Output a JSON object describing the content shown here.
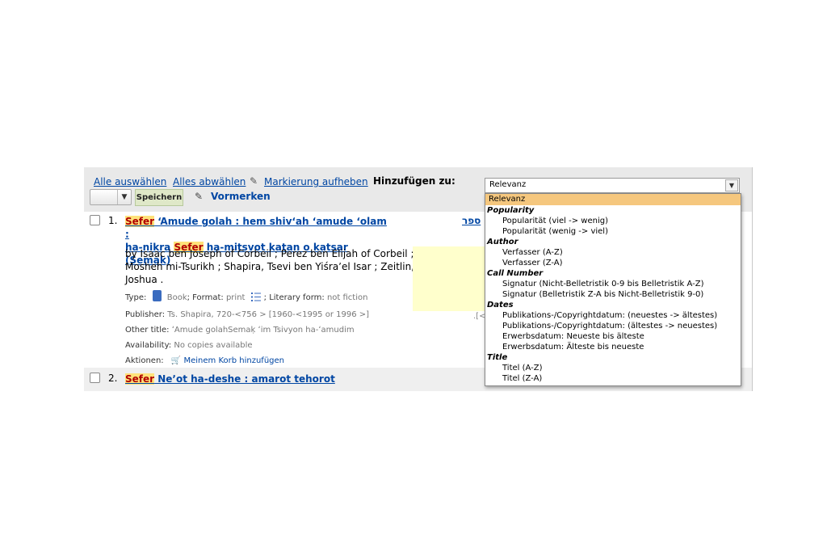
{
  "toolbar": {
    "select_all": "Alle auswählen",
    "clear_all": "Alles abwählen",
    "unhighlight": "Markierung aufheben",
    "add_to_label": "Hinzufügen zu:",
    "save": "Speichern",
    "place_hold": "Vormerken"
  },
  "sort": {
    "selected": "Relevanz",
    "options": [
      {
        "label": "Relevanz",
        "selected": true
      },
      {
        "group": "Popularity"
      },
      {
        "label": "Popularität (viel -> wenig)"
      },
      {
        "label": "Popularität (wenig -> viel)"
      },
      {
        "group": "Author"
      },
      {
        "label": "Verfasser (A-Z)"
      },
      {
        "label": "Verfasser (Z-A)"
      },
      {
        "group": "Call Number"
      },
      {
        "label": "Signatur (Nicht-Belletristik 0-9 bis Belletristik A-Z)"
      },
      {
        "label": "Signatur (Belletristik Z-A bis Nicht-Belletristik 9-0)"
      },
      {
        "group": "Dates"
      },
      {
        "label": "Publikations-/Copyrightdatum: (neuestes -> ältestes)"
      },
      {
        "label": "Publikations-/Copyrightdatum: (ältestes -> neuestes)"
      },
      {
        "label": "Erwerbsdatum: Neueste bis älteste"
      },
      {
        "label": "Erwerbsdatum: Älteste bis neueste"
      },
      {
        "group": "Title"
      },
      {
        "label": "Titel (A-Z)"
      },
      {
        "label": "Titel (Z-A)"
      }
    ]
  },
  "results": [
    {
      "number": "1.",
      "title_hl": "Sefer",
      "title_part1": " ʻAmude golah : hem shivʻah ʻamude ʻolam :",
      "title_part2": "ha-nikra ",
      "title_hl2": "Sefer",
      "title_part3": " ha-mitsvot katan o katsar (Semak)",
      "hebrew_title": "ספר",
      "authors": "by Isaac ben Joseph of Corbeil ; Perez ben Elijah of Corbeil ; Mosheh mi-Tsurikh ; Shapira, Tsevi ben Yiśraʼel Isar ; Zeitlin, Joshua .",
      "type_label": "Type:",
      "type_value": "Book",
      "format_label": "; Format:",
      "format_value": "print",
      "literary_label": "; Literary form:",
      "literary_value": "not fiction",
      "publisher_label": "Publisher:",
      "publisher_value": "Ts. Shapira, 720-<756 > [1960-<1995 or 1996 >]",
      "other_title_label": "Other title:",
      "other_title_value": "ʻAmude golahSemaḳ ʻim Tsivyon ha-ʻamudim",
      "availability_label": "Availability:",
      "availability_value": "No copies available",
      "actions_label": "Aktionen:",
      "cart_label": "Meinem Korb hinzufügen",
      "cover_note": ".[<"
    },
    {
      "number": "2.",
      "title_hl": "Sefer",
      "title_rest": " Neʼot ha-deshe : amarot tehorot"
    }
  ],
  "icons": {
    "unhighlight": "eraser-icon",
    "place_hold": "place-hold-icon",
    "book": "book-icon",
    "format": "list-icon",
    "cart": "cart-icon",
    "chevron": "chevron-down-icon"
  },
  "colors": {
    "link": "#0046a3",
    "highlight_bg": "#ffe27a",
    "highlight_fg": "#b00000",
    "selected_option": "#f5c77e",
    "toolbar_bg": "#e9e9e9"
  }
}
